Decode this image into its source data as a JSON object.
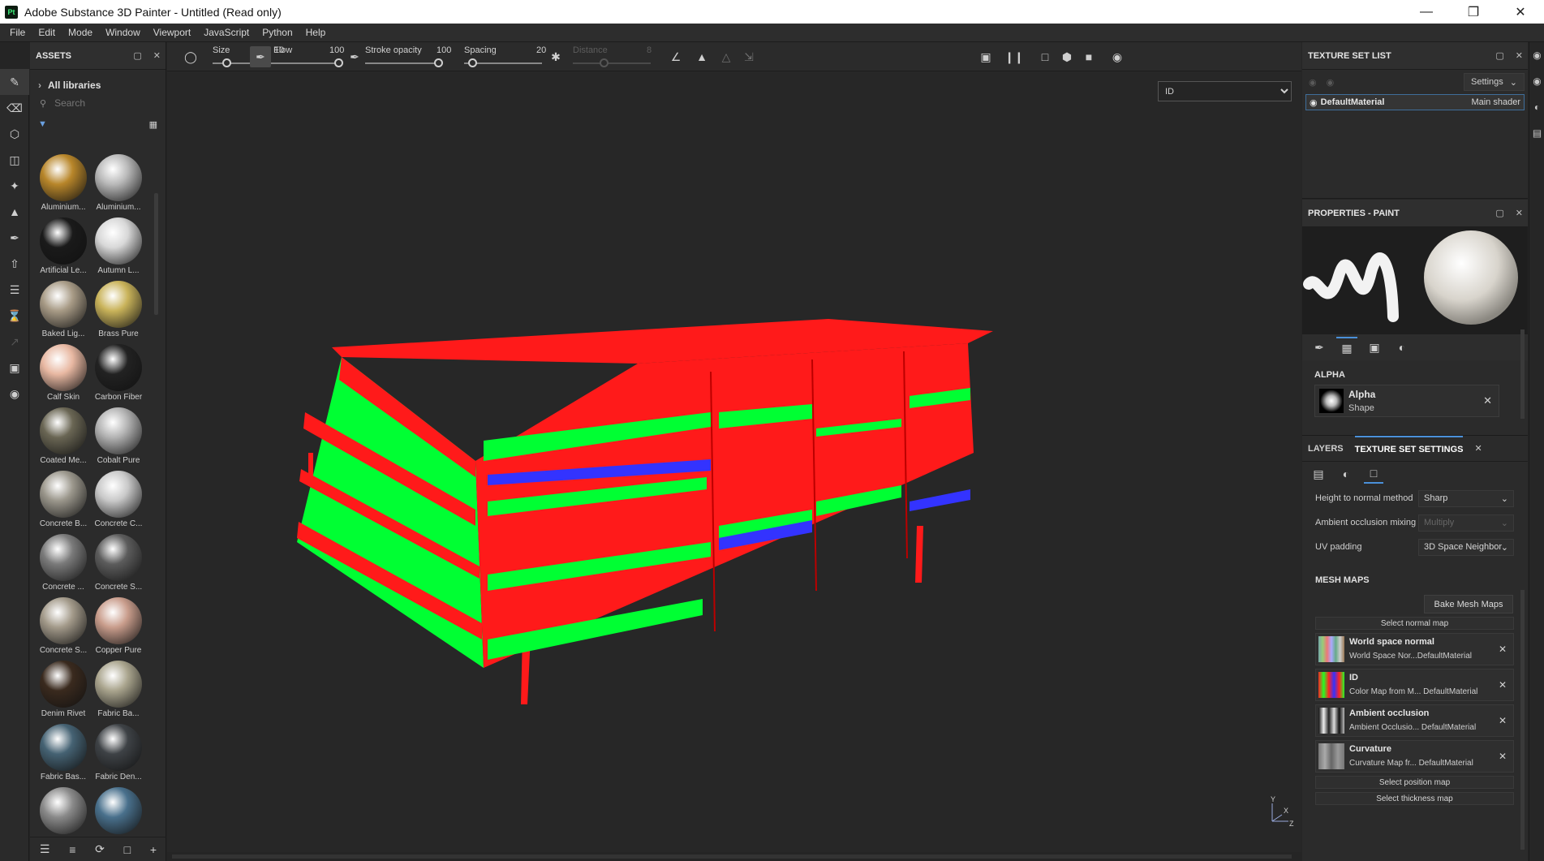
{
  "window": {
    "title": "Adobe Substance 3D Painter - Untitled (Read only)",
    "app_icon": "Pt"
  },
  "menu": [
    "File",
    "Edit",
    "Mode",
    "Window",
    "Viewport",
    "JavaScript",
    "Python",
    "Help"
  ],
  "assets": {
    "title": "ASSETS",
    "libraries": "All libraries",
    "search_placeholder": "Search",
    "items": [
      {
        "label": "Aluminium...",
        "color": "#b8862a"
      },
      {
        "label": "Aluminium...",
        "color": "#b9b9b9"
      },
      {
        "label": "Artificial Le...",
        "color": "#1a1a1a"
      },
      {
        "label": "Autumn L...",
        "color": "#d8d8d8"
      },
      {
        "label": "Baked Lig...",
        "color": "#a89b86"
      },
      {
        "label": "Brass Pure",
        "color": "#c9b35a"
      },
      {
        "label": "Calf Skin",
        "color": "#e8b8a2"
      },
      {
        "label": "Carbon Fiber",
        "color": "#222222"
      },
      {
        "label": "Coated Me...",
        "color": "#6a6654"
      },
      {
        "label": "Cobalt Pure",
        "color": "#b3b3b3"
      },
      {
        "label": "Concrete B...",
        "color": "#9b978c"
      },
      {
        "label": "Concrete C...",
        "color": "#c9c9c9"
      },
      {
        "label": "Concrete ...",
        "color": "#7a7a7a"
      },
      {
        "label": "Concrete S...",
        "color": "#5c5c5c"
      },
      {
        "label": "Concrete S...",
        "color": "#a39a8a"
      },
      {
        "label": "Copper Pure",
        "color": "#c99d8c"
      },
      {
        "label": "Denim Rivet",
        "color": "#3a2a1e"
      },
      {
        "label": "Fabric Ba...",
        "color": "#aaa58e"
      },
      {
        "label": "Fabric Bas...",
        "color": "#456273"
      },
      {
        "label": "Fabric Den...",
        "color": "#3e4246"
      },
      {
        "label": "",
        "color": "#8a8a8a"
      },
      {
        "label": "",
        "color": "#49708c"
      }
    ]
  },
  "toolbar": {
    "size": {
      "label": "Size",
      "value": "10",
      "level": 0.2
    },
    "flow": {
      "label": "Flow",
      "value": "100",
      "level": 1.0
    },
    "stroke_opacity": {
      "label": "Stroke opacity",
      "value": "100",
      "level": 1.0
    },
    "spacing": {
      "label": "Spacing",
      "value": "20",
      "level": 0.1
    },
    "distance": {
      "label": "Distance",
      "value": "8",
      "level": 0.4
    }
  },
  "viewport": {
    "channel_select": "ID",
    "channel_options": [
      "ID"
    ],
    "axis": {
      "y": "Y",
      "x": "X",
      "z": "Z"
    }
  },
  "texture_set_list": {
    "title": "TEXTURE SET LIST",
    "settings_label": "Settings",
    "material_name": "DefaultMaterial",
    "shader": "Main shader"
  },
  "properties": {
    "title": "PROPERTIES - PAINT",
    "alpha_section": "ALPHA",
    "alpha_name": "Alpha",
    "alpha_type": "Shape"
  },
  "texture_set_settings": {
    "tab_layers": "LAYERS",
    "tab_settings": "TEXTURE SET SETTINGS",
    "height_to_normal_label": "Height to normal method",
    "height_to_normal_value": "Sharp",
    "ao_mixing_label": "Ambient occlusion mixing",
    "ao_mixing_value": "Multiply",
    "uv_padding_label": "UV padding",
    "uv_padding_value": "3D Space Neighbor",
    "mesh_maps_title": "MESH MAPS",
    "bake_label": "Bake Mesh Maps",
    "select_normal": "Select normal map",
    "select_position": "Select position map",
    "select_thickness": "Select thickness map",
    "maps": [
      {
        "name": "World space normal",
        "sub": "World Space Nor...DefaultMaterial"
      },
      {
        "name": "ID",
        "sub": "Color Map from M... DefaultMaterial"
      },
      {
        "name": "Ambient occlusion",
        "sub": "Ambient Occlusio... DefaultMaterial"
      },
      {
        "name": "Curvature",
        "sub": "Curvature Map fr... DefaultMaterial"
      }
    ]
  }
}
